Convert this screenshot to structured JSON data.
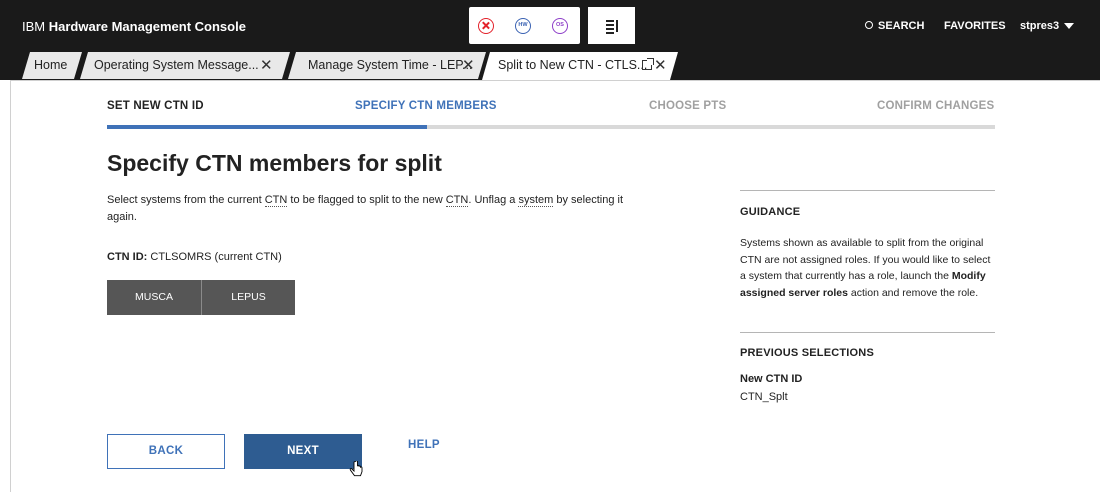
{
  "header": {
    "brand_prefix": "IBM ",
    "brand_name": "Hardware Management Console",
    "status_icons": [
      "error-icon",
      "hardware-messages-icon",
      "os-messages-icon"
    ],
    "status_hw_label": "HW",
    "status_os_label": "OS",
    "task_list_icon": "task-list-icon",
    "search_label": "SEARCH",
    "favorites_label": "FAVORITES",
    "user_label": "stpres3"
  },
  "tabs": [
    {
      "label": "Home"
    },
    {
      "label": "Operating System Message..."
    },
    {
      "label": "Manage System Time - LEP..."
    },
    {
      "label": "Split to New CTN - CTLS..."
    }
  ],
  "wizard": {
    "steps": [
      {
        "label": "SET NEW CTN ID",
        "state": "done"
      },
      {
        "label": "SPECIFY CTN MEMBERS",
        "state": "current"
      },
      {
        "label": "CHOOSE PTS",
        "state": "todo"
      },
      {
        "label": "CONFIRM CHANGES",
        "state": "todo"
      }
    ],
    "progress_fraction": 0.36
  },
  "main": {
    "title": "Specify CTN members for split",
    "desc_1": "Select systems from the current ",
    "desc_ctn_1": "CTN",
    "desc_2": " to be flagged to split to the new ",
    "desc_ctn_2": "CTN",
    "desc_3": ". Unflag a ",
    "desc_system": "system",
    "desc_4": " by selecting it again.",
    "ctn_label": "CTN ID:",
    "ctn_value": " CTLSOMRS (current CTN)",
    "systems": [
      "MUSCA",
      "LEPUS"
    ]
  },
  "guidance": {
    "title": "GUIDANCE",
    "text_1": "Systems shown as available to split from the original CTN are not assigned roles. If you would like to select a system that currently has a role, launch the ",
    "text_bold": "Modify assigned server roles",
    "text_2": " action and remove the role."
  },
  "previous": {
    "title": "PREVIOUS SELECTIONS",
    "label": "New CTN ID",
    "value": "CTN_Splt"
  },
  "footer": {
    "back_label": "BACK",
    "next_label": "NEXT",
    "help_label": "HELP"
  },
  "colors": {
    "accent": "#3f72b8",
    "next_button": "#2e5c91",
    "topbar": "#1a1a1a",
    "system_button": "#565656"
  }
}
